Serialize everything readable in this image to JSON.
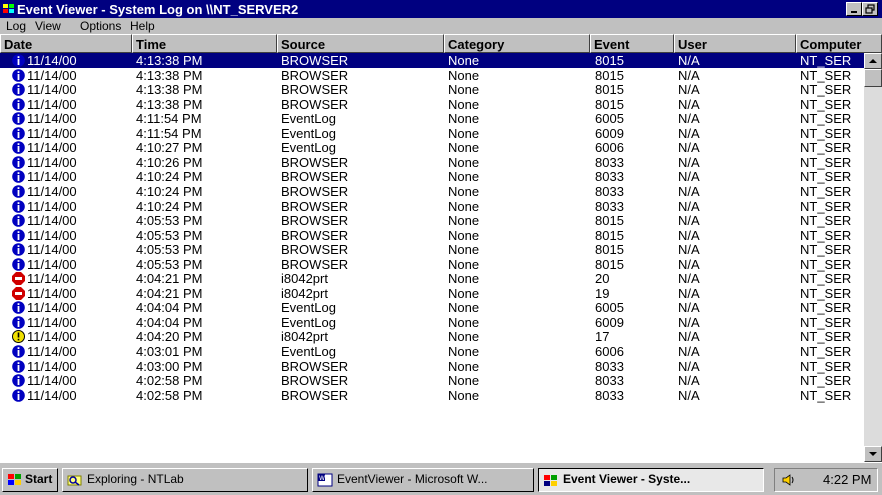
{
  "window": {
    "title": "Event Viewer - System Log on \\\\NT_SERVER2"
  },
  "menu": [
    "Log",
    "View",
    "Options",
    "Help"
  ],
  "columns": [
    "Date",
    "Time",
    "Source",
    "Category",
    "Event",
    "User",
    "Computer"
  ],
  "rows": [
    {
      "icon": "info",
      "date": "11/14/00",
      "time": "4:13:38 PM",
      "source": "BROWSER",
      "category": "None",
      "event": "8015",
      "user": "N/A",
      "computer": "NT_SER"
    },
    {
      "icon": "info",
      "date": "11/14/00",
      "time": "4:13:38 PM",
      "source": "BROWSER",
      "category": "None",
      "event": "8015",
      "user": "N/A",
      "computer": "NT_SER"
    },
    {
      "icon": "info",
      "date": "11/14/00",
      "time": "4:13:38 PM",
      "source": "BROWSER",
      "category": "None",
      "event": "8015",
      "user": "N/A",
      "computer": "NT_SER"
    },
    {
      "icon": "info",
      "date": "11/14/00",
      "time": "4:13:38 PM",
      "source": "BROWSER",
      "category": "None",
      "event": "8015",
      "user": "N/A",
      "computer": "NT_SER"
    },
    {
      "icon": "info",
      "date": "11/14/00",
      "time": "4:11:54 PM",
      "source": "EventLog",
      "category": "None",
      "event": "6005",
      "user": "N/A",
      "computer": "NT_SER"
    },
    {
      "icon": "info",
      "date": "11/14/00",
      "time": "4:11:54 PM",
      "source": "EventLog",
      "category": "None",
      "event": "6009",
      "user": "N/A",
      "computer": "NT_SER"
    },
    {
      "icon": "info",
      "date": "11/14/00",
      "time": "4:10:27 PM",
      "source": "EventLog",
      "category": "None",
      "event": "6006",
      "user": "N/A",
      "computer": "NT_SER"
    },
    {
      "icon": "info",
      "date": "11/14/00",
      "time": "4:10:26 PM",
      "source": "BROWSER",
      "category": "None",
      "event": "8033",
      "user": "N/A",
      "computer": "NT_SER"
    },
    {
      "icon": "info",
      "date": "11/14/00",
      "time": "4:10:24 PM",
      "source": "BROWSER",
      "category": "None",
      "event": "8033",
      "user": "N/A",
      "computer": "NT_SER"
    },
    {
      "icon": "info",
      "date": "11/14/00",
      "time": "4:10:24 PM",
      "source": "BROWSER",
      "category": "None",
      "event": "8033",
      "user": "N/A",
      "computer": "NT_SER"
    },
    {
      "icon": "info",
      "date": "11/14/00",
      "time": "4:10:24 PM",
      "source": "BROWSER",
      "category": "None",
      "event": "8033",
      "user": "N/A",
      "computer": "NT_SER"
    },
    {
      "icon": "info",
      "date": "11/14/00",
      "time": "4:05:53 PM",
      "source": "BROWSER",
      "category": "None",
      "event": "8015",
      "user": "N/A",
      "computer": "NT_SER"
    },
    {
      "icon": "info",
      "date": "11/14/00",
      "time": "4:05:53 PM",
      "source": "BROWSER",
      "category": "None",
      "event": "8015",
      "user": "N/A",
      "computer": "NT_SER"
    },
    {
      "icon": "info",
      "date": "11/14/00",
      "time": "4:05:53 PM",
      "source": "BROWSER",
      "category": "None",
      "event": "8015",
      "user": "N/A",
      "computer": "NT_SER"
    },
    {
      "icon": "info",
      "date": "11/14/00",
      "time": "4:05:53 PM",
      "source": "BROWSER",
      "category": "None",
      "event": "8015",
      "user": "N/A",
      "computer": "NT_SER"
    },
    {
      "icon": "error",
      "date": "11/14/00",
      "time": "4:04:21 PM",
      "source": "i8042prt",
      "category": "None",
      "event": "20",
      "user": "N/A",
      "computer": "NT_SER"
    },
    {
      "icon": "error",
      "date": "11/14/00",
      "time": "4:04:21 PM",
      "source": "i8042prt",
      "category": "None",
      "event": "19",
      "user": "N/A",
      "computer": "NT_SER"
    },
    {
      "icon": "info",
      "date": "11/14/00",
      "time": "4:04:04 PM",
      "source": "EventLog",
      "category": "None",
      "event": "6005",
      "user": "N/A",
      "computer": "NT_SER"
    },
    {
      "icon": "info",
      "date": "11/14/00",
      "time": "4:04:04 PM",
      "source": "EventLog",
      "category": "None",
      "event": "6009",
      "user": "N/A",
      "computer": "NT_SER"
    },
    {
      "icon": "warning",
      "date": "11/14/00",
      "time": "4:04:20 PM",
      "source": "i8042prt",
      "category": "None",
      "event": "17",
      "user": "N/A",
      "computer": "NT_SER"
    },
    {
      "icon": "info",
      "date": "11/14/00",
      "time": "4:03:01 PM",
      "source": "EventLog",
      "category": "None",
      "event": "6006",
      "user": "N/A",
      "computer": "NT_SER"
    },
    {
      "icon": "info",
      "date": "11/14/00",
      "time": "4:03:00 PM",
      "source": "BROWSER",
      "category": "None",
      "event": "8033",
      "user": "N/A",
      "computer": "NT_SER"
    },
    {
      "icon": "info",
      "date": "11/14/00",
      "time": "4:02:58 PM",
      "source": "BROWSER",
      "category": "None",
      "event": "8033",
      "user": "N/A",
      "computer": "NT_SER"
    },
    {
      "icon": "info",
      "date": "11/14/00",
      "time": "4:02:58 PM",
      "source": "BROWSER",
      "category": "None",
      "event": "8033",
      "user": "N/A",
      "computer": "NT_SER"
    }
  ],
  "selected_row": 0,
  "taskbar": {
    "start_label": "Start",
    "buttons": [
      {
        "label": "Exploring - NTLab",
        "icon": "explorer-icon",
        "active": false
      },
      {
        "label": "EventViewer - Microsoft W...",
        "icon": "word-icon",
        "active": false
      },
      {
        "label": "Event Viewer - Syste...",
        "icon": "event-viewer-icon",
        "active": true
      }
    ],
    "clock": "4:22 PM"
  },
  "colors": {
    "title_bar": "#000080",
    "selection": "#000080",
    "face": "#c0c0c0",
    "info_icon": "#0000c0",
    "error_icon": "#d00000",
    "warning_icon": "#f0e000"
  }
}
